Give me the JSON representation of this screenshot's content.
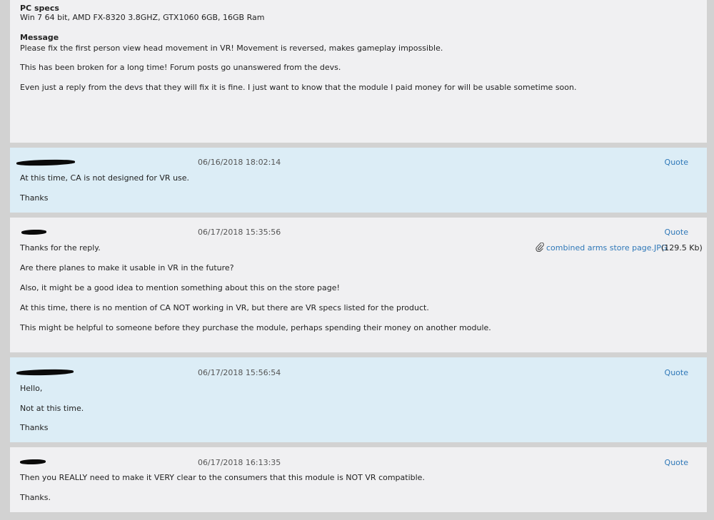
{
  "first_post": {
    "pc_specs_label": "PC specs",
    "pc_specs_value": "Win 7 64 bit, AMD FX-8320 3.8GHZ, GTX1060 6GB, 16GB Ram",
    "message_label": "Message",
    "lines": [
      "Please fix the first person view head movement in VR! Movement is reversed, makes gameplay impossible.",
      "This has been broken for a long time! Forum posts go unanswered from the devs.",
      "Even just a reply from the devs that they will fix it is fine. I just want to know that the module I paid money for will be usable sometime soon."
    ]
  },
  "replies": [
    {
      "timestamp": "06/16/2018 18:02:14",
      "quote_label": "Quote",
      "lines": [
        "At this time, CA is not designed for VR use.",
        "Thanks"
      ]
    },
    {
      "timestamp": "06/17/2018 15:35:56",
      "quote_label": "Quote",
      "attachment": {
        "name": "combined arms store page.JPG",
        "size": "(129.5 Kb)",
        "icon": "paperclip-icon"
      },
      "lines": [
        "Thanks for the reply.",
        "Are there planes to make it usable in VR in the future?",
        "Also, it might be a good idea to mention something about this on the store page!",
        "At this time, there is no mention of CA NOT working in VR, but there are VR specs listed for the product.",
        "This might be helpful to someone before they purchase the module, perhaps spending their money on another module."
      ]
    },
    {
      "timestamp": "06/17/2018 15:56:54",
      "quote_label": "Quote",
      "lines": [
        "Hello,",
        "Not at this time.",
        "Thanks"
      ]
    },
    {
      "timestamp": "06/17/2018 16:13:35",
      "quote_label": "Quote",
      "lines": [
        "Then you REALLY need to make it VERY clear to the consumers that this module is NOT VR compatible.",
        "Thanks."
      ]
    }
  ],
  "colors": {
    "page_bg": "#d2d2d2",
    "user_post_bg": "#f0f0f2",
    "staff_post_bg": "#dcedf6",
    "link": "#2f78b8"
  }
}
